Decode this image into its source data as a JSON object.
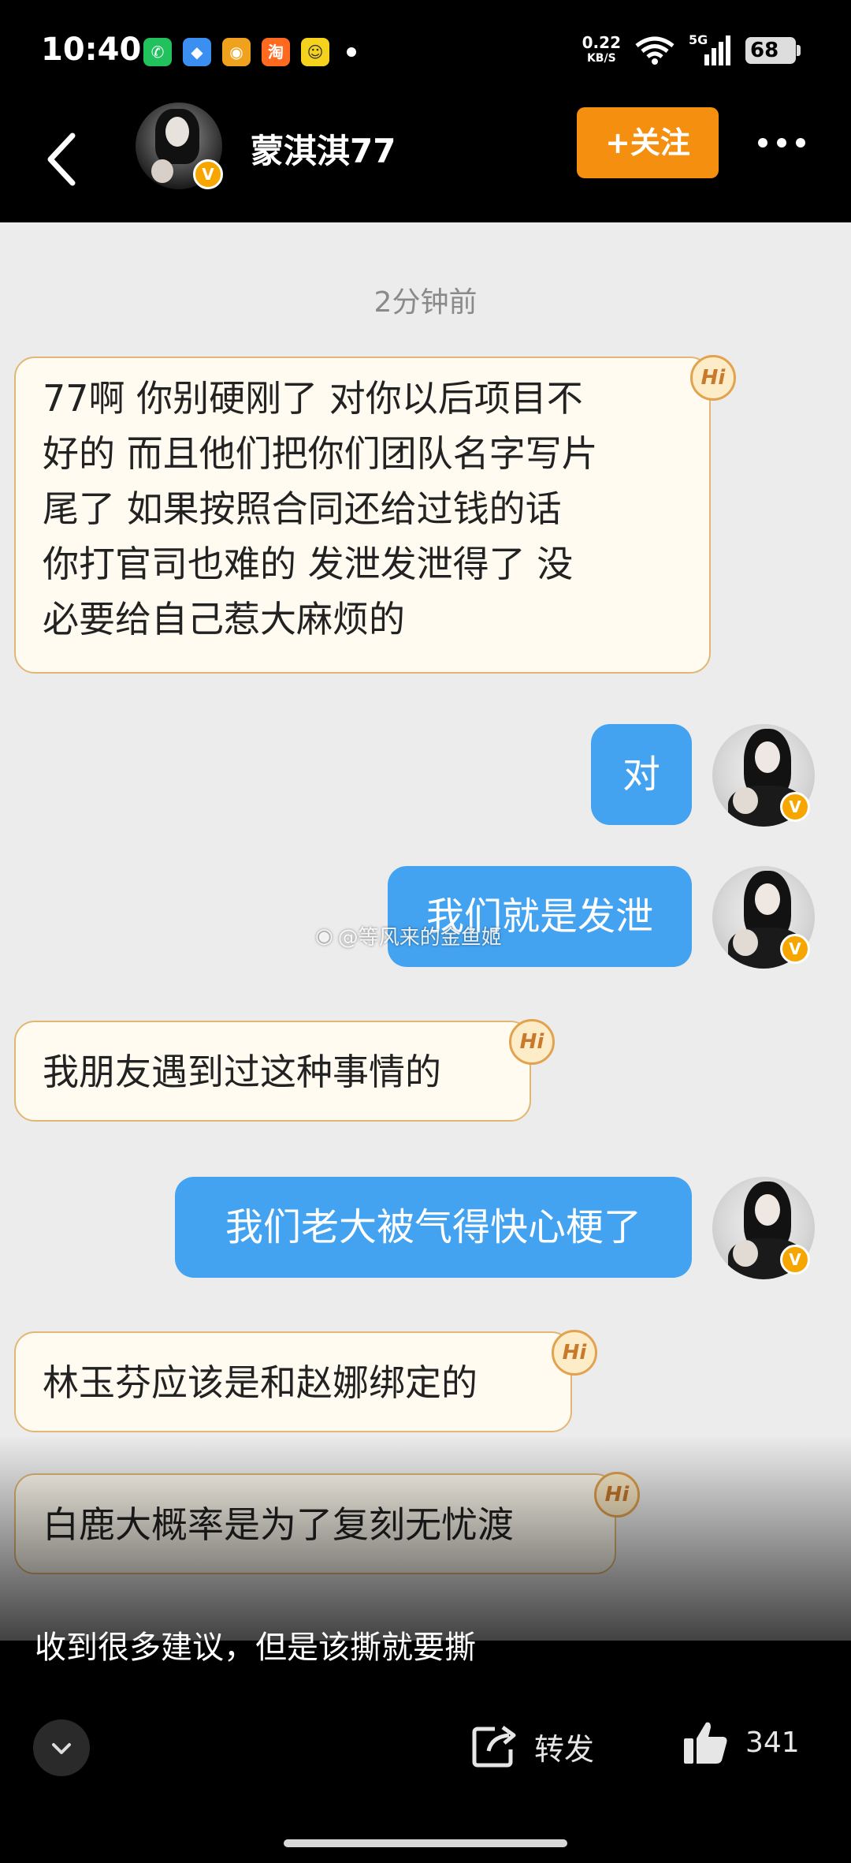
{
  "status_bar": {
    "time": "10:40",
    "apps": [
      {
        "name": "wechat-icon",
        "glyph": "✆",
        "color": "#21c25e"
      },
      {
        "name": "blue-app-icon",
        "glyph": "◆",
        "color": "#3b8ff0"
      },
      {
        "name": "weibo-icon",
        "glyph": "◉",
        "color": "#f0a21f"
      },
      {
        "name": "taobao-icon",
        "glyph": "淘",
        "color": "#ff6a1f"
      },
      {
        "name": "yellow-app-icon",
        "glyph": "☺",
        "color": "#f5d21c"
      }
    ],
    "net_speed": "0.22",
    "net_unit": "KB/S",
    "signal": "5G",
    "battery": "68"
  },
  "header": {
    "username": "蒙淇淇77",
    "follow_label": "+关注",
    "verified_badge": "V"
  },
  "chat": {
    "timestamp": "2分钟前",
    "hi_badge": "Hi",
    "messages": [
      {
        "side": "in",
        "text": "77啊 你别硬刚了 对你以后项目不\n好的 而且他们把你们团队名字写片\n尾了 如果按照合同还给过钱的话\n你打官司也难的 发泄发泄得了 没\n必要给自己惹大麻烦的"
      },
      {
        "side": "out",
        "text": "对"
      },
      {
        "side": "out",
        "text": "我们就是发泄"
      },
      {
        "side": "in",
        "text": "我朋友遇到过这种事情的"
      },
      {
        "side": "out",
        "text": "我们老大被气得快心梗了"
      },
      {
        "side": "in",
        "text": "林玉芬应该是和赵娜绑定的"
      },
      {
        "side": "in",
        "text": "白鹿大概率是为了复刻无忧渡"
      }
    ],
    "watermark": "@等风来的金鱼姬"
  },
  "caption": "收到很多建议，但是该撕就要撕",
  "actions": {
    "share_label": "转发",
    "like_count": "341"
  },
  "colors": {
    "accent_orange": "#f58f0f",
    "bubble_out": "#44a3f0",
    "bubble_in": "#fffbf0",
    "verified": "#f7a600"
  }
}
